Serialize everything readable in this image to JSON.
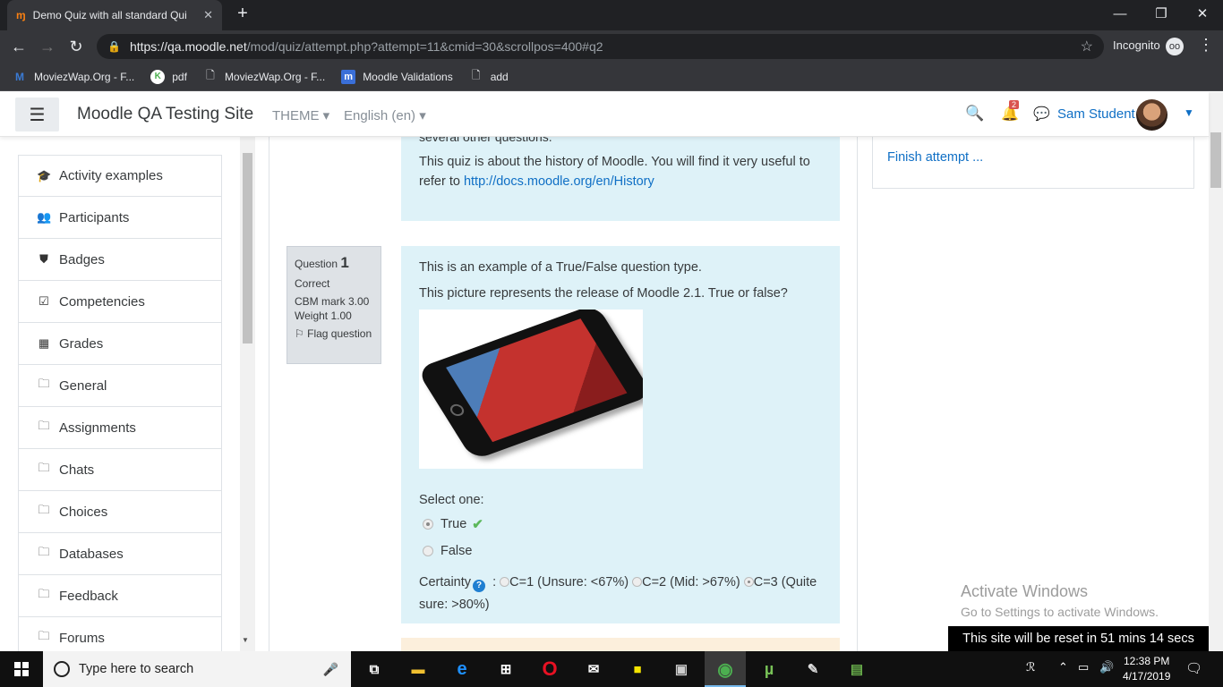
{
  "browser": {
    "tab_title": "Demo Quiz with all standard Qui",
    "url_scheme": "https://",
    "url_host": "qa.moodle.net",
    "url_path": "/mod/quiz/attempt.php?attempt=11&cmid=30&scrollpos=400#q2",
    "incognito_label": "Incognito",
    "bookmarks": [
      {
        "label": "MoviezWap.Org - F...",
        "icon": "moviezwap-icon"
      },
      {
        "label": "pdf",
        "icon": "pdf-icon"
      },
      {
        "label": "MoviezWap.Org - F...",
        "icon": "page-icon"
      },
      {
        "label": "Moodle Validations",
        "icon": "moodle-icon"
      },
      {
        "label": "add",
        "icon": "page-icon"
      }
    ]
  },
  "navbar": {
    "site_name": "Moodle QA Testing Site",
    "theme_label": "THEME",
    "language_label": "English (en)",
    "notification_count": "2",
    "user_name": "Sam Student"
  },
  "sidenav": {
    "items": [
      {
        "label": "Activity examples",
        "icon": "graduation-cap-icon",
        "glyph": "🎓"
      },
      {
        "label": "Participants",
        "icon": "users-icon",
        "glyph": "👥"
      },
      {
        "label": "Badges",
        "icon": "shield-icon",
        "glyph": "⛊"
      },
      {
        "label": "Competencies",
        "icon": "check-square-icon",
        "glyph": "☑"
      },
      {
        "label": "Grades",
        "icon": "table-icon",
        "glyph": "▦"
      },
      {
        "label": "General",
        "icon": "folder-icon",
        "glyph": "🗀"
      },
      {
        "label": "Assignments",
        "icon": "folder-icon",
        "glyph": "🗀"
      },
      {
        "label": "Chats",
        "icon": "folder-icon",
        "glyph": "🗀"
      },
      {
        "label": "Choices",
        "icon": "folder-icon",
        "glyph": "🗀"
      },
      {
        "label": "Databases",
        "icon": "folder-icon",
        "glyph": "🗀"
      },
      {
        "label": "Feedback",
        "icon": "folder-icon",
        "glyph": "🗀"
      },
      {
        "label": "Forums",
        "icon": "folder-icon",
        "glyph": "🗀"
      }
    ]
  },
  "intro": {
    "cut_text": "several other questions.",
    "text": "This quiz is about the history of Moodle. You will find it very useful to refer to ",
    "link": "http://docs.moodle.org/en/History"
  },
  "question": {
    "label": "Question",
    "number": "1",
    "state": "Correct",
    "cbm_mark": "CBM mark 3.00",
    "weight": "Weight 1.00",
    "flag_label": "Flag question",
    "text1": "This is an example of a True/False question type.",
    "text2": "This picture represents the release of  Moodle 2.1. True or false?",
    "select_label": "Select one:",
    "options": [
      {
        "label": "True",
        "selected": true,
        "correct": true
      },
      {
        "label": "False",
        "selected": false,
        "correct": false
      }
    ],
    "certainty_label": "Certainty",
    "certainty_options": [
      {
        "label": "C=1 (Unsure: <67%)",
        "selected": false
      },
      {
        "label": "C=2 (Mid: >67%)",
        "selected": false
      },
      {
        "label": "C=3 (Quite sure: >80%)",
        "selected": true
      }
    ]
  },
  "quiz_nav": {
    "finish_label": "Finish attempt ..."
  },
  "watermark": {
    "line1": "Activate Windows",
    "line2": "Go to Settings to activate Windows."
  },
  "reset_notice": "This site will be reset in 51 mins 14 secs",
  "taskbar": {
    "search_placeholder": "Type here to search",
    "time": "12:38 PM",
    "date": "4/17/2019"
  },
  "colors": {
    "link": "#0f6fc5",
    "question_bg": "#def2f8",
    "correct_check": "#5cb85c"
  }
}
